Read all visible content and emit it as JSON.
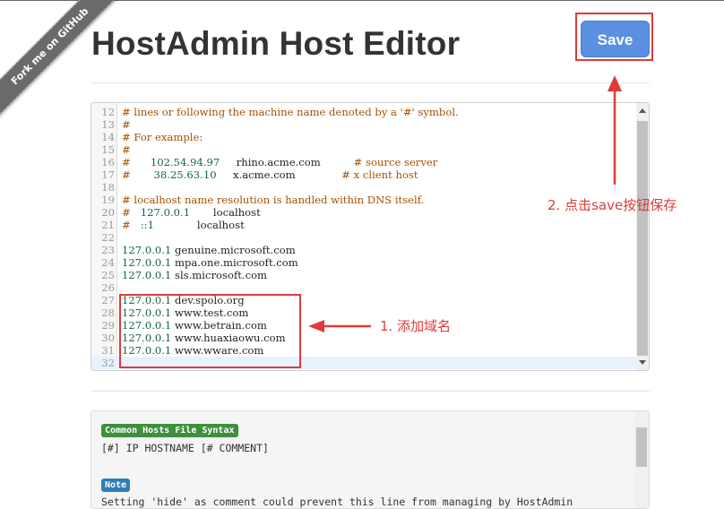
{
  "ribbon": {
    "text": "Fork me on GitHub"
  },
  "header": {
    "title": "HostAdmin Host Editor",
    "save_label": "Save"
  },
  "editor": {
    "lines": [
      {
        "num": "12",
        "parts": [
          {
            "cls": "c-com",
            "text": "# lines or following the machine name denoted by a '#' symbol."
          }
        ]
      },
      {
        "num": "13",
        "parts": [
          {
            "cls": "c-com",
            "text": "#"
          }
        ]
      },
      {
        "num": "14",
        "parts": [
          {
            "cls": "c-com",
            "text": "# For example:"
          }
        ]
      },
      {
        "num": "15",
        "parts": [
          {
            "cls": "c-com",
            "text": "#"
          }
        ]
      },
      {
        "num": "16",
        "parts": [
          {
            "cls": "c-com",
            "text": "#"
          },
          {
            "cls": "c-ip",
            "text": "      102.54.94.97"
          },
          {
            "cls": "c-host",
            "text": "     rhino.acme.com"
          },
          {
            "cls": "c-com",
            "text": "          # source server"
          }
        ]
      },
      {
        "num": "17",
        "parts": [
          {
            "cls": "c-com",
            "text": "#"
          },
          {
            "cls": "c-ip",
            "text": "       38.25.63.10"
          },
          {
            "cls": "c-host",
            "text": "     x.acme.com"
          },
          {
            "cls": "c-com",
            "text": "              # x client host"
          }
        ]
      },
      {
        "num": "18",
        "parts": [
          {
            "cls": "c-host",
            "text": ""
          }
        ]
      },
      {
        "num": "19",
        "parts": [
          {
            "cls": "c-com",
            "text": "# localhost name resolution is handled within DNS itself."
          }
        ]
      },
      {
        "num": "20",
        "parts": [
          {
            "cls": "c-com",
            "text": "#"
          },
          {
            "cls": "c-ip",
            "text": "   127.0.0.1"
          },
          {
            "cls": "c-host",
            "text": "       localhost"
          }
        ]
      },
      {
        "num": "21",
        "parts": [
          {
            "cls": "c-com",
            "text": "#"
          },
          {
            "cls": "c-ip",
            "text": "   ::1"
          },
          {
            "cls": "c-host",
            "text": "             localhost"
          }
        ]
      },
      {
        "num": "22",
        "parts": [
          {
            "cls": "c-host",
            "text": ""
          }
        ]
      },
      {
        "num": "23",
        "parts": [
          {
            "cls": "c-ip",
            "text": "127.0.0.1"
          },
          {
            "cls": "c-host",
            "text": " genuine.microsoft.com"
          }
        ]
      },
      {
        "num": "24",
        "parts": [
          {
            "cls": "c-ip",
            "text": "127.0.0.1"
          },
          {
            "cls": "c-host",
            "text": " mpa.one.microsoft.com"
          }
        ]
      },
      {
        "num": "25",
        "parts": [
          {
            "cls": "c-ip",
            "text": "127.0.0.1"
          },
          {
            "cls": "c-host",
            "text": " sls.microsoft.com"
          }
        ]
      },
      {
        "num": "26",
        "parts": [
          {
            "cls": "c-host",
            "text": ""
          }
        ]
      },
      {
        "num": "27",
        "parts": [
          {
            "cls": "c-ip",
            "text": "127.0.0.1"
          },
          {
            "cls": "c-host",
            "text": " dev.spolo.org"
          }
        ]
      },
      {
        "num": "28",
        "parts": [
          {
            "cls": "c-ip",
            "text": "127.0.0.1"
          },
          {
            "cls": "c-host",
            "text": " www.test.com"
          }
        ]
      },
      {
        "num": "29",
        "parts": [
          {
            "cls": "c-ip",
            "text": "127.0.0.1"
          },
          {
            "cls": "c-host",
            "text": " www.betrain.com"
          }
        ]
      },
      {
        "num": "30",
        "parts": [
          {
            "cls": "c-ip",
            "text": "127.0.0.1"
          },
          {
            "cls": "c-host",
            "text": " www.huaxiaowu.com"
          }
        ]
      },
      {
        "num": "31",
        "parts": [
          {
            "cls": "c-ip",
            "text": "127.0.0.1"
          },
          {
            "cls": "c-host",
            "text": " www.wware.com"
          }
        ]
      },
      {
        "num": "32",
        "parts": [
          {
            "cls": "c-host",
            "text": ""
          }
        ],
        "active": true
      }
    ]
  },
  "annotations": {
    "step1": "1. 添加域名",
    "step2": "2. 点击save按钮保存"
  },
  "help": {
    "syntax_badge": "Common Hosts File Syntax",
    "syntax_text": "[#] IP HOSTNAME [# COMMENT]",
    "note_badge": "Note",
    "note_text": "Setting 'hide' as comment could prevent this line from managing by HostAdmin"
  },
  "colors": {
    "save": "#5b8fe0",
    "annotation": "#e03a3a",
    "ribbon": "#6a6a6a"
  }
}
